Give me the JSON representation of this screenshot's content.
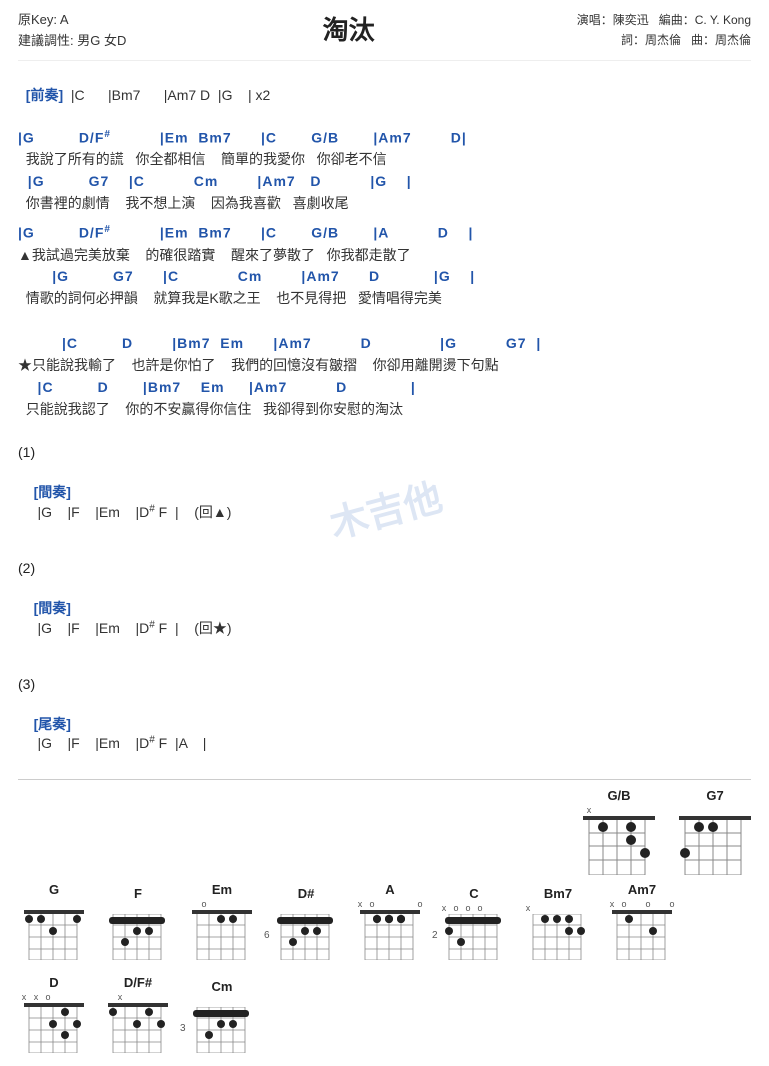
{
  "header": {
    "original_key": "原Key: A",
    "suggested_key": "建議調性: 男G 女D",
    "title": "淘汰",
    "singer": "演唱：陳奕迅",
    "arranger": "編曲：C. Y. Kong",
    "lyricist": "詞：周杰倫",
    "composer": "曲：周杰倫"
  },
  "intro": "[前奏]  |C      |Bm7      |Am7 D  |G    | x2",
  "sections": [
    {
      "id": "section1",
      "chords": "|G         D/F#          |Em  Bm7      |C       G/B       |Am7        D|",
      "lyrics": "  我說了所有的謊   你全都相信    簡單的我愛你   你卻老不信"
    },
    {
      "id": "section2",
      "chords": "  |G         G7    |C          Cm        |Am7   D          |G    |",
      "lyrics": "  你書裡的劇情    我不想上演    因為我喜歡   喜劇收尾"
    },
    {
      "id": "section3",
      "chords": "|G         D/F#          |Em  Bm7      |C       G/B       |A          D    |",
      "lyrics": "▲我試過完美放棄    的確很踏實    醒來了夢散了   你我都走散了"
    },
    {
      "id": "section4",
      "chords": "       |G         G7      |C            Cm        |Am7      D           |G    |",
      "lyrics": "  情歌的詞何必押韻    就算我是K歌之王    也不見得把   愛情唱得完美"
    },
    {
      "id": "section5",
      "chords": "         |C         D        |Bm7  Em      |Am7          D              |G          G7  |",
      "lyrics": "★只能說我輸了    也許是你怕了    我們的回憶沒有皺摺    你卻用離開燙下句點"
    },
    {
      "id": "section6",
      "chords": "    |C         D       |Bm7    Em     |Am7          D             |",
      "lyrics": "  只能說我認了    你的不安贏得你信住   我卻得到你安慰的淘汰"
    }
  ],
  "numbered_sections": [
    {
      "num": "(1)",
      "content": "[間奏] |G    |F    |Em    |D# F  |    (回▲)"
    },
    {
      "num": "(2)",
      "content": "[間奏] |G    |F    |Em    |D# F  |    (回★)"
    },
    {
      "num": "(3)",
      "content": "[尾奏] |G    |F    |Em    |D# F  |A    |"
    }
  ],
  "watermark": "木吉他",
  "chord_diagrams_top": [
    {
      "name": "G/B",
      "fret_start": null,
      "markers": [
        "x",
        "",
        "",
        ""
      ],
      "dots": [
        [
          0,
          1
        ],
        [
          0,
          2
        ],
        [
          1,
          0
        ],
        [
          2,
          3
        ]
      ]
    },
    {
      "name": "G7",
      "fret_start": null,
      "markers": [
        "",
        "",
        "",
        ""
      ],
      "dots": [
        [
          0,
          1
        ],
        [
          1,
          0
        ],
        [
          2,
          2
        ],
        [
          3,
          3
        ]
      ]
    }
  ],
  "chord_diagrams_bottom": [
    {
      "name": "G",
      "fret_num": null
    },
    {
      "name": "F",
      "fret_num": null
    },
    {
      "name": "Em",
      "fret_num": null
    },
    {
      "name": "D#",
      "fret_num": "6"
    },
    {
      "name": "A",
      "fret_num": null
    },
    {
      "name": "C",
      "fret_num": "2"
    },
    {
      "name": "Bm7",
      "fret_num": null
    },
    {
      "name": "Am7",
      "fret_num": null
    },
    {
      "name": "D",
      "fret_num": null
    },
    {
      "name": "D/F#",
      "fret_num": null
    },
    {
      "name": "Cm",
      "fret_num": "3"
    }
  ]
}
